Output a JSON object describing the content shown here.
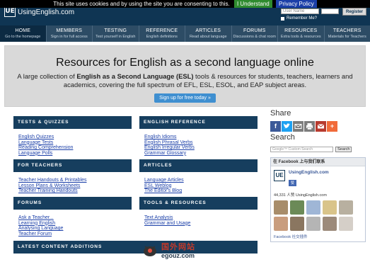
{
  "cookie_bar": {
    "message": "This site uses cookies and by using the site you are consenting to this.",
    "accept": "I Understand",
    "policy": "Privacy Policy"
  },
  "header": {
    "logo_mark": "UE",
    "site_name": "UsingEnglish.com",
    "username_placeholder": "User Name",
    "remember_me": "Remember Me?",
    "register": "Register"
  },
  "nav": [
    {
      "title": "HOME",
      "sub": "Go to the homepage"
    },
    {
      "title": "MEMBERS",
      "sub": "Sign in for full access"
    },
    {
      "title": "TESTING",
      "sub": "Test yourself in English"
    },
    {
      "title": "REFERENCE",
      "sub": "English definitions"
    },
    {
      "title": "ARTICLES",
      "sub": "Read about language"
    },
    {
      "title": "FORUMS",
      "sub": "Discussions & chat room"
    },
    {
      "title": "RESOURCES",
      "sub": "Extra tools & resources"
    },
    {
      "title": "TEACHERS",
      "sub": "Materials for Teachers"
    }
  ],
  "hero": {
    "title": "Resources for English as a second language online",
    "lead_pre": "A large collection of ",
    "lead_bold": "English as a Second Language (ESL)",
    "lead_post": " tools & resources for students, teachers, learners and academics, covering the full spectrum of EFL, ESL, ESOL, and EAP subject areas.",
    "cta": "Sign up for free today »"
  },
  "sections": {
    "tests": {
      "title": "TESTS & QUIZZES",
      "links": [
        "English Quizzes",
        "Language Tests",
        "Reading Comprehension",
        "Language Polls"
      ]
    },
    "reference": {
      "title": "ENGLISH REFERENCE",
      "links": [
        "English Idioms",
        "English Phrasal Verbs",
        "English Irregular Verbs",
        "Grammar Glossary"
      ]
    },
    "teachers": {
      "title": "FOR TEACHERS",
      "links": [
        "Teacher Handouts & Printables",
        "Lesson Plans & Worksheets",
        "Teacher Training Handouts"
      ]
    },
    "articles": {
      "title": "ARTICLES",
      "links": [
        "Language Articles",
        "ESL Weblog",
        "The Editor's Blog"
      ]
    },
    "forums": {
      "title": "FORUMS",
      "links": [
        "Ask a Teacher...",
        "Learning English",
        "Analysing Language",
        "Teacher Forum"
      ]
    },
    "tools": {
      "title": "TOOLS & RESOURCES",
      "links": [
        "Text Analysis",
        "Grammar and Usage"
      ]
    },
    "latest": {
      "title": "LATEST CONTENT ADDITIONS"
    }
  },
  "sidebar": {
    "share_title": "Share",
    "search_title": "Search",
    "search_placeholder": "Google™ Custom Search",
    "search_button": "Search",
    "fb_header": "在 Facebook 上与我们联系",
    "fb_page_name": "UsingEnglish.com",
    "fb_like": "赞",
    "fb_count": "44,331 人赞 UsingEnglish.com",
    "fb_footer": "Facebook 社交插件"
  },
  "watermark": {
    "cn": "国外网站",
    "en": "egouz.com"
  },
  "colors": {
    "header": "#0f3553",
    "nav": "#2d4c65",
    "section_head": "#163e5e",
    "link": "#1b3fa8",
    "cta": "#3f8fd0"
  }
}
